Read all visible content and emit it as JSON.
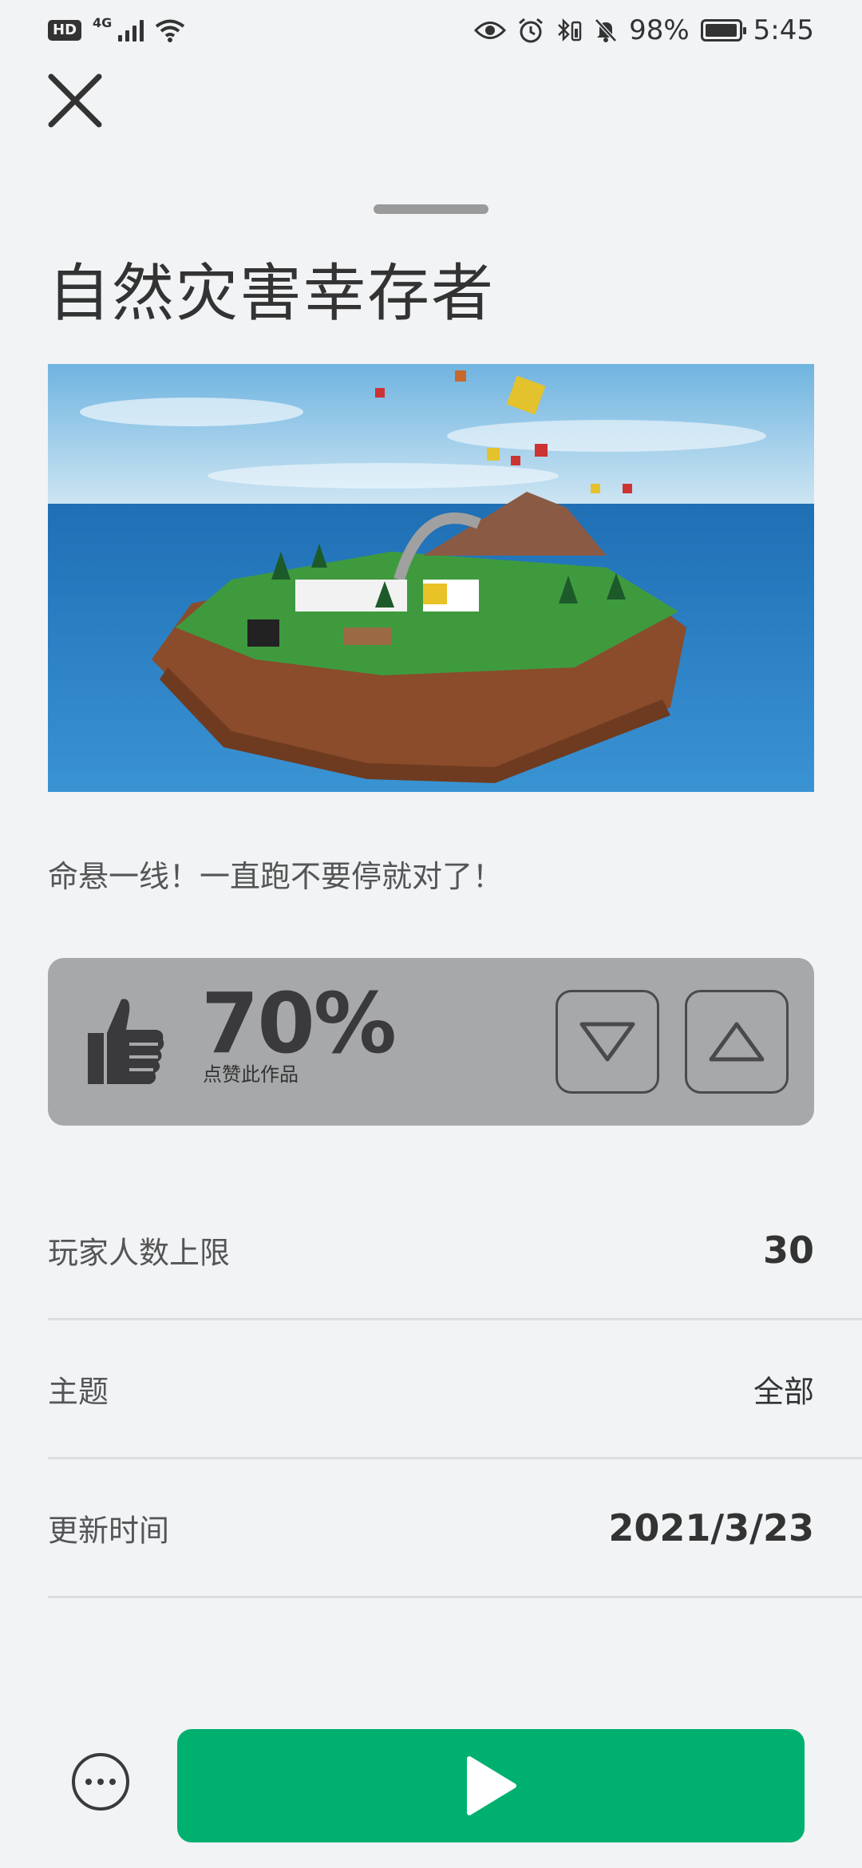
{
  "status_bar": {
    "hd": "HD",
    "network": "4G",
    "battery_percent": "98%",
    "battery_level": 0.98,
    "time": "5:45"
  },
  "game": {
    "title": "自然灾害幸存者",
    "description": "命悬一线！一直跑不要停就对了！"
  },
  "rating": {
    "percent": "70%",
    "label": "点赞此作品"
  },
  "details": [
    {
      "label": "玩家人数上限",
      "value": "30"
    },
    {
      "label": "主题",
      "value": "全部"
    },
    {
      "label": "更新时间",
      "value": "2021/3/23"
    }
  ],
  "colors": {
    "play_button": "#00b06f",
    "vote_panel": "#a7a8aa",
    "background": "#f1f3f5"
  },
  "icons": {
    "close": "close-icon",
    "like": "thumbs-up-icon",
    "downvote": "triangle-down-icon",
    "upvote": "triangle-up-icon",
    "more": "more-horizontal-icon",
    "play": "play-icon"
  }
}
